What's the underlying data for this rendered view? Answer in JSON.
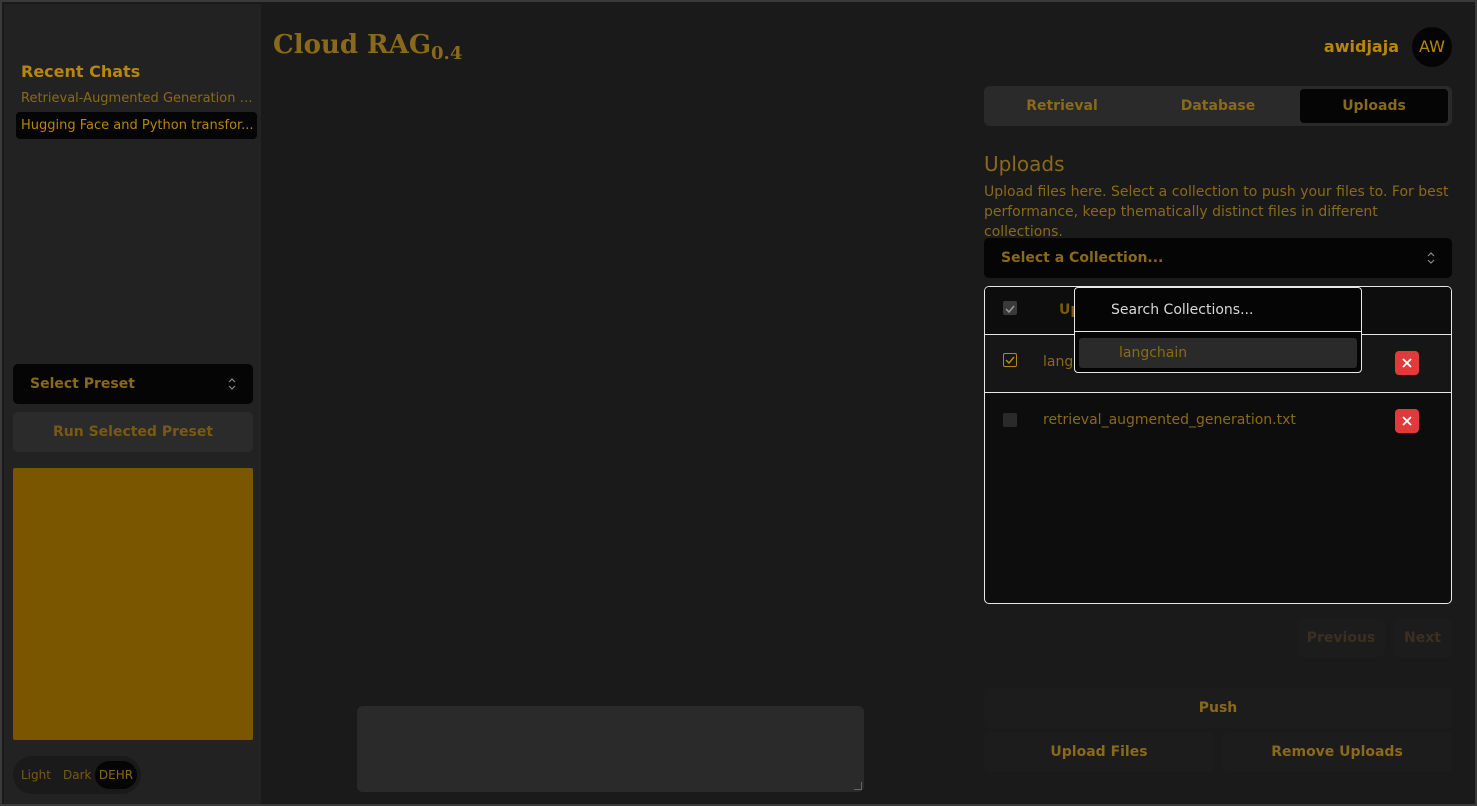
{
  "app": {
    "title": "Cloud RAG",
    "version": "0.4"
  },
  "user": {
    "name": "awidjaja",
    "initials": "AW"
  },
  "sidebar": {
    "recent_title": "Recent Chats",
    "chats": [
      {
        "label": "Retrieval-Augmented Generation a..."
      },
      {
        "label": "Hugging Face and Python transfor...",
        "selected": true
      }
    ],
    "preset_select": "Select Preset",
    "run_preset": "Run Selected Preset",
    "theme": {
      "options": [
        "Light",
        "Dark",
        "DEHR"
      ],
      "selected": "DEHR"
    }
  },
  "tabs": [
    {
      "label": "Retrieval"
    },
    {
      "label": "Database"
    },
    {
      "label": "Uploads",
      "active": true
    }
  ],
  "uploads": {
    "heading": "Uploads",
    "description": "Upload files here. Select a collection to push your files to. For best performance, keep thematically distinct files in different collections.",
    "collection_select": "Select a Collection...",
    "table_header_partial": "Up",
    "files": [
      {
        "name": "lang",
        "checked": true
      },
      {
        "name": "retrieval_augmented_generation.txt",
        "checked": false
      }
    ],
    "dropdown": {
      "search_placeholder": "Search Collections...",
      "options": [
        "langchain"
      ]
    },
    "pagination": {
      "previous": "Previous",
      "next": "Next"
    },
    "push": "Push",
    "upload_files": "Upload Files",
    "remove_uploads": "Remove Uploads"
  },
  "colors": {
    "accent": "#b8860b",
    "delete": "#e03a3a",
    "gold_panel": "#7a5600"
  }
}
